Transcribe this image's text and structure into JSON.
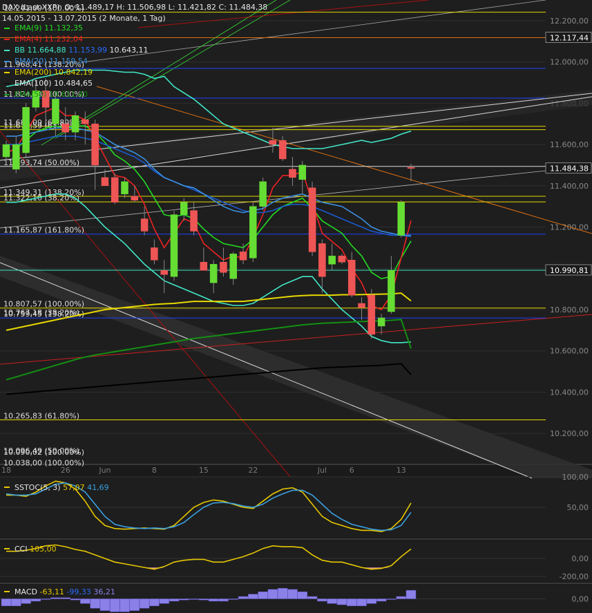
{
  "header": {
    "symbol": "DAX (Last XXP)",
    "ohlc": "O: 11.489,17  H: 11.506,98  L: 11.421,82  C: 11.484,38",
    "range": "14.05.2015 - 13.07.2015 (2 Monate, 1 Tag)"
  },
  "legend": [
    {
      "label": "EMA(9)",
      "value": "11.132,35",
      "color": "#22dd22"
    },
    {
      "label": "EMA(4)",
      "value": "11.232,04",
      "color": "#ee2222"
    },
    {
      "label": "BB",
      "value": "11.664,88",
      "value2": "11.153,99",
      "value3": "10.643,11",
      "color": "#40e8c8"
    },
    {
      "label": "EMA(20)",
      "value": "11.159,54",
      "color": "#3a8fe0"
    },
    {
      "label": "EMA(200)",
      "value": "10.842,19",
      "color": "#e8d800"
    },
    {
      "label": "EMA(100)",
      "value": "10.484,65",
      "color": "#111111"
    },
    {
      "label": "EMA(50)",
      "value": "10.611,40",
      "color": "#139013"
    }
  ],
  "price_labels": [
    {
      "text": "12.117,44",
      "price": 12117.44,
      "bg": "#1a1a1a",
      "fg": "#ffffff",
      "border": "#888888"
    },
    {
      "text": "11.484,38",
      "price": 11484.38,
      "bg": "#1a1a1a",
      "fg": "#ffffff",
      "border": "#888888"
    },
    {
      "text": "10.990,81",
      "price": 10990.81,
      "bg": "#1a1a1a",
      "fg": "#ffffff",
      "border": "#888888"
    }
  ],
  "fib_labels": [
    {
      "text": "12.241,09 (100.00%)",
      "price": 12241.09
    },
    {
      "text": "11.968,41 (138.20%)",
      "price": 11968.41
    },
    {
      "text": "11.824,38 (100.00%)",
      "price": 11824.38
    },
    {
      "text": "11.688,09 (61.80%)",
      "price": 11688.09
    },
    {
      "text": "11.671,59 (61.80%)",
      "price": 11671.59
    },
    {
      "text": "11.493,74 (50.00%)",
      "price": 11493.74
    },
    {
      "text": "11.349,31 (138.20%)",
      "price": 11349.31
    },
    {
      "text": "11.322,10 (38.20%)",
      "price": 11322.1
    },
    {
      "text": "11.165,87 (161.80%)",
      "price": 11165.87
    },
    {
      "text": "10.807,57 (100.00%)",
      "price": 10807.57
    },
    {
      "text": "10.767,18 (38.20%)",
      "price": 10767.18
    },
    {
      "text": "10.759,45 (138.20%)",
      "price": 10759.45
    },
    {
      "text": "10.265,83 (61.80%)",
      "price": 10265.83
    },
    {
      "text": "10.096,49 (50.00%)",
      "price": 10096.49
    },
    {
      "text": "10.090,02 (100.00%)",
      "price": 10090.02
    },
    {
      "text": "10.038,00 (100.00%)",
      "price": 10038.0
    }
  ],
  "subpanels": {
    "sstoc": {
      "label": "SSTOC(5, 3)",
      "value": "57,07",
      "value2": "41,69",
      "ticks": [
        "100,00",
        "50,00"
      ]
    },
    "cci": {
      "label": "CCI",
      "value": "105,00",
      "ticks": [
        "0,00",
        "-200,00"
      ]
    },
    "macd": {
      "label": "MACD",
      "value": "-63,11",
      "value2": "-99,33",
      "value3": "36,21",
      "ticks": [
        "0,00"
      ]
    }
  },
  "chart_data": {
    "type": "candlestick",
    "x_tick_labels": [
      {
        "label": "18",
        "index": 0
      },
      {
        "label": "26",
        "index": 6
      },
      {
        "label": "Jun",
        "index": 10
      },
      {
        "label": "8",
        "index": 15
      },
      {
        "label": "15",
        "index": 20
      },
      {
        "label": "22",
        "index": 25
      },
      {
        "label": "Jul",
        "index": 32
      },
      {
        "label": "6",
        "index": 35
      },
      {
        "label": "13",
        "index": 40
      }
    ],
    "y_ticks": [
      10200,
      10400,
      10600,
      10800,
      11000,
      11200,
      11400,
      11600,
      11800,
      12000,
      12200
    ],
    "y_tick_labels": [
      "10.200,00",
      "10.400,00",
      "10.600,00",
      "10.800,00",
      "",
      "11.200,00",
      "11.400,00",
      "11.600,00",
      "11.800,00",
      "12.000,00",
      "12.200,00"
    ],
    "ylim": [
      10050,
      12300
    ],
    "candles": [
      {
        "o": 11540,
        "h": 11620,
        "l": 11500,
        "c": 11600
      },
      {
        "o": 11480,
        "h": 11640,
        "l": 11460,
        "c": 11600
      },
      {
        "o": 11560,
        "h": 11800,
        "l": 11540,
        "c": 11780
      },
      {
        "o": 11780,
        "h": 11920,
        "l": 11760,
        "c": 11860
      },
      {
        "o": 11860,
        "h": 11920,
        "l": 11700,
        "c": 11780
      },
      {
        "o": 11700,
        "h": 11850,
        "l": 11640,
        "c": 11820
      },
      {
        "o": 11700,
        "h": 11780,
        "l": 11620,
        "c": 11660
      },
      {
        "o": 11660,
        "h": 11760,
        "l": 11620,
        "c": 11740
      },
      {
        "o": 11720,
        "h": 11760,
        "l": 11600,
        "c": 11700
      },
      {
        "o": 11700,
        "h": 11720,
        "l": 11380,
        "c": 11500
      },
      {
        "o": 11440,
        "h": 11480,
        "l": 11400,
        "c": 11400
      },
      {
        "o": 11440,
        "h": 11460,
        "l": 11310,
        "c": 11320
      },
      {
        "o": 11360,
        "h": 11440,
        "l": 11340,
        "c": 11420
      },
      {
        "o": 11350,
        "h": 11400,
        "l": 11320,
        "c": 11330
      },
      {
        "o": 11240,
        "h": 11300,
        "l": 11160,
        "c": 11180
      },
      {
        "o": 11100,
        "h": 11140,
        "l": 11020,
        "c": 11040
      },
      {
        "o": 10990,
        "h": 11040,
        "l": 10880,
        "c": 10970
      },
      {
        "o": 10960,
        "h": 11280,
        "l": 10940,
        "c": 11260
      },
      {
        "o": 11260,
        "h": 11340,
        "l": 11230,
        "c": 11320
      },
      {
        "o": 11280,
        "h": 11320,
        "l": 11160,
        "c": 11180
      },
      {
        "o": 11030,
        "h": 11100,
        "l": 11000,
        "c": 10990
      },
      {
        "o": 10930,
        "h": 11040,
        "l": 10880,
        "c": 11020
      },
      {
        "o": 11030,
        "h": 11100,
        "l": 10960,
        "c": 10980
      },
      {
        "o": 10950,
        "h": 11080,
        "l": 10920,
        "c": 11070
      },
      {
        "o": 11080,
        "h": 11120,
        "l": 11020,
        "c": 11040
      },
      {
        "o": 11050,
        "h": 11320,
        "l": 11030,
        "c": 11300
      },
      {
        "o": 11300,
        "h": 11440,
        "l": 11280,
        "c": 11420
      },
      {
        "o": 11620,
        "h": 11680,
        "l": 11560,
        "c": 11600
      },
      {
        "o": 11620,
        "h": 11640,
        "l": 11520,
        "c": 11530
      },
      {
        "o": 11480,
        "h": 11540,
        "l": 11400,
        "c": 11440
      },
      {
        "o": 11430,
        "h": 11520,
        "l": 11360,
        "c": 11500
      },
      {
        "o": 11390,
        "h": 11420,
        "l": 11060,
        "c": 11080
      },
      {
        "o": 11120,
        "h": 11140,
        "l": 10880,
        "c": 10960
      },
      {
        "o": 11020,
        "h": 11120,
        "l": 10990,
        "c": 11060
      },
      {
        "o": 11060,
        "h": 11070,
        "l": 11020,
        "c": 11030
      },
      {
        "o": 11040,
        "h": 11080,
        "l": 10860,
        "c": 10870
      },
      {
        "o": 10830,
        "h": 10860,
        "l": 10750,
        "c": 10810
      },
      {
        "o": 10870,
        "h": 10900,
        "l": 10660,
        "c": 10680
      },
      {
        "o": 10720,
        "h": 10780,
        "l": 10680,
        "c": 10760
      },
      {
        "o": 10790,
        "h": 11060,
        "l": 10780,
        "c": 10990
      },
      {
        "o": 11160,
        "h": 11330,
        "l": 11150,
        "c": 11320
      },
      {
        "o": 11489.17,
        "h": 11506.98,
        "l": 11421.82,
        "c": 11484.38
      }
    ],
    "series": [
      {
        "name": "EMA(9)",
        "values": [
          11560,
          11580,
          11620,
          11660,
          11680,
          11690,
          11680,
          11690,
          11690,
          11660,
          11610,
          11550,
          11520,
          11480,
          11420,
          11340,
          11260,
          11250,
          11260,
          11240,
          11190,
          11150,
          11120,
          11110,
          11100,
          11140,
          11200,
          11260,
          11300,
          11320,
          11340,
          11290,
          11230,
          11200,
          11170,
          11110,
          11060,
          10980,
          10950,
          10960,
          11050,
          11132.35
        ]
      },
      {
        "name": "EMA(4)",
        "values": [
          11560,
          11580,
          11660,
          11740,
          11760,
          11780,
          11740,
          11740,
          11720,
          11630,
          11540,
          11450,
          11440,
          11400,
          11310,
          11190,
          11100,
          11170,
          11240,
          11220,
          11120,
          11080,
          11040,
          11060,
          11050,
          11150,
          11260,
          11390,
          11450,
          11450,
          11470,
          11320,
          11170,
          11130,
          11090,
          11000,
          10930,
          10820,
          10800,
          10870,
          11050,
          11232.04
        ]
      },
      {
        "name": "BB upper",
        "values": [
          11880,
          11890,
          11900,
          11920,
          11930,
          11940,
          11950,
          11960,
          11960,
          11960,
          11960,
          11955,
          11950,
          11950,
          11940,
          11920,
          11930,
          11880,
          11850,
          11820,
          11780,
          11740,
          11700,
          11680,
          11660,
          11640,
          11620,
          11600,
          11590,
          11580,
          11580,
          11580,
          11580,
          11590,
          11600,
          11610,
          11620,
          11610,
          11620,
          11630,
          11650,
          11664.88
        ]
      },
      {
        "name": "BB middle",
        "values": [
          11600,
          11600,
          11610,
          11620,
          11630,
          11640,
          11640,
          11640,
          11630,
          11620,
          11600,
          11580,
          11560,
          11540,
          11510,
          11470,
          11440,
          11420,
          11400,
          11380,
          11360,
          11340,
          11320,
          11300,
          11280,
          11270,
          11270,
          11280,
          11300,
          11310,
          11310,
          11300,
          11280,
          11260,
          11240,
          11220,
          11200,
          11180,
          11170,
          11160,
          11160,
          11153.99
        ]
      },
      {
        "name": "BB lower",
        "values": [
          11320,
          11320,
          11330,
          11340,
          11350,
          11360,
          11360,
          11340,
          11300,
          11250,
          11200,
          11160,
          11120,
          11070,
          11020,
          10980,
          10940,
          10920,
          10900,
          10880,
          10860,
          10840,
          10830,
          10820,
          10820,
          10830,
          10860,
          10890,
          10920,
          10940,
          10960,
          10960,
          10900,
          10850,
          10800,
          10760,
          10720,
          10670,
          10650,
          10640,
          10640,
          10643.11
        ]
      },
      {
        "name": "EMA(20)",
        "values": [
          11640,
          11640,
          11650,
          11660,
          11670,
          11680,
          11680,
          11680,
          11670,
          11660,
          11630,
          11600,
          11580,
          11560,
          11530,
          11480,
          11440,
          11420,
          11400,
          11390,
          11360,
          11330,
          11300,
          11280,
          11270,
          11280,
          11290,
          11320,
          11340,
          11350,
          11360,
          11340,
          11320,
          11310,
          11300,
          11270,
          11240,
          11200,
          11180,
          11170,
          11160,
          11159.54
        ]
      },
      {
        "name": "EMA(200)",
        "values": [
          10700,
          10710,
          10720,
          10730,
          10740,
          10750,
          10760,
          10770,
          10780,
          10790,
          10800,
          10805,
          10810,
          10815,
          10820,
          10825,
          10828,
          10830,
          10835,
          10840,
          10840,
          10840,
          10840,
          10840,
          10840,
          10845,
          10850,
          10855,
          10860,
          10865,
          10868,
          10870,
          10870,
          10870,
          10872,
          10872,
          10873,
          10874,
          10875,
          10876,
          10880,
          10842.19
        ]
      },
      {
        "name": "EMA(100)",
        "values": [
          10390,
          10394,
          10398,
          10402,
          10406,
          10410,
          10414,
          10418,
          10422,
          10426,
          10430,
          10434,
          10438,
          10442,
          10446,
          10450,
          10454,
          10458,
          10462,
          10466,
          10470,
          10474,
          10478,
          10482,
          10486,
          10490,
          10494,
          10498,
          10502,
          10506,
          10510,
          10514,
          10518,
          10520,
          10522,
          10524,
          10526,
          10528,
          10530,
          10534,
          10538,
          10484.65
        ]
      },
      {
        "name": "EMA(50)",
        "values": [
          10460,
          10474,
          10488,
          10502,
          10516,
          10530,
          10544,
          10558,
          10570,
          10580,
          10588,
          10596,
          10604,
          10612,
          10620,
          10628,
          10636,
          10644,
          10652,
          10660,
          10666,
          10672,
          10678,
          10684,
          10690,
          10696,
          10702,
          10708,
          10714,
          10720,
          10726,
          10730,
          10734,
          10736,
          10738,
          10740,
          10742,
          10744,
          10746,
          10748,
          10752,
          10611.4
        ]
      }
    ],
    "sstoc_series": [
      {
        "name": "%K",
        "values": [
          70,
          70,
          68,
          75,
          85,
          93,
          90,
          80,
          60,
          35,
          20,
          15,
          14,
          15,
          16,
          15,
          14,
          20,
          35,
          50,
          58,
          62,
          60,
          55,
          50,
          48,
          60,
          72,
          80,
          82,
          75,
          55,
          35,
          25,
          20,
          15,
          12,
          12,
          10,
          15,
          30,
          57.07
        ]
      },
      {
        "name": "%D",
        "values": [
          72,
          70,
          70,
          72,
          80,
          88,
          90,
          85,
          75,
          55,
          35,
          22,
          18,
          16,
          15,
          16,
          15,
          18,
          25,
          38,
          50,
          57,
          58,
          56,
          52,
          50,
          55,
          65,
          72,
          78,
          78,
          70,
          55,
          40,
          30,
          22,
          18,
          14,
          12,
          13,
          20,
          41.69
        ]
      }
    ],
    "sstoc_ylim": [
      0,
      100
    ],
    "cci_series": [
      {
        "name": "CCI",
        "values": [
          80,
          80,
          90,
          110,
          140,
          150,
          130,
          100,
          80,
          40,
          0,
          -40,
          -60,
          -80,
          -100,
          -120,
          -90,
          -40,
          -20,
          -10,
          -10,
          -40,
          -40,
          -10,
          20,
          60,
          110,
          140,
          130,
          130,
          120,
          40,
          -20,
          -40,
          -40,
          -70,
          -100,
          -120,
          -110,
          -80,
          20,
          105
        ]
      }
    ],
    "cci_ylim": [
      -260,
      200
    ],
    "macd_series": [
      {
        "name": "Histogram",
        "values": [
          -30,
          -30,
          -20,
          -10,
          0,
          5,
          5,
          -5,
          -20,
          -40,
          -50,
          -55,
          -55,
          -50,
          -40,
          -30,
          -20,
          -10,
          -5,
          0,
          -5,
          -10,
          -10,
          0,
          10,
          20,
          30,
          40,
          45,
          40,
          30,
          10,
          -10,
          -20,
          -25,
          -30,
          -30,
          -20,
          -10,
          0,
          10,
          36.21
        ]
      }
    ],
    "macd_ylim": [
      -60,
      60
    ]
  }
}
